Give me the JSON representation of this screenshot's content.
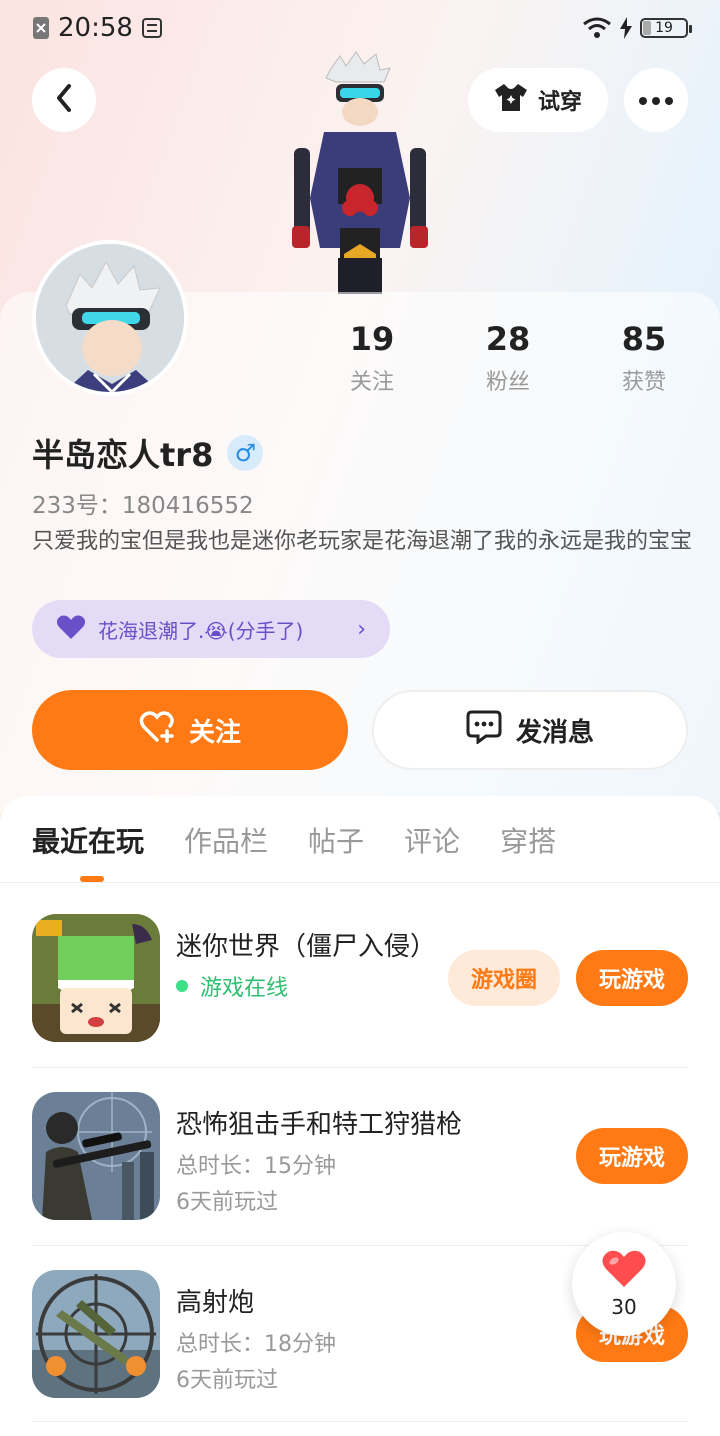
{
  "status_bar": {
    "time": "20:58",
    "battery": "19"
  },
  "header": {
    "back_icon": "chevron-left-icon",
    "try_on_label": "试穿",
    "more_icon": "more-dots-icon"
  },
  "profile": {
    "stats": [
      {
        "num": "19",
        "label": "关注"
      },
      {
        "num": "28",
        "label": "粉丝"
      },
      {
        "num": "85",
        "label": "获赞"
      }
    ],
    "username": "半岛恋人tr8",
    "gender_symbol": "♂",
    "uid": "233号：180416552",
    "bio": "只爱我的宝但是我也是迷你老玩家是花海退潮了我的永远是我的宝宝",
    "tag": "花海退潮了.😭(分手了)",
    "tag_chevron": "›"
  },
  "actions": {
    "follow_label": "关注",
    "message_label": "发消息"
  },
  "tabs": [
    "最近在玩",
    "作品栏",
    "帖子",
    "评论",
    "穿搭"
  ],
  "games": [
    {
      "title": "迷你世界（僵尸入侵）",
      "online": "游戏在线",
      "circle_label": "游戏圈",
      "play_label": "玩游戏"
    },
    {
      "title": "恐怖狙击手和特工狩猎枪",
      "duration": "总时长：15分钟",
      "last_played": "6天前玩过",
      "play_label": "玩游戏"
    },
    {
      "title": "高射炮",
      "duration": "总时长：18分钟",
      "last_played": "6天前玩过",
      "play_label": "玩游戏"
    }
  ],
  "like_float": {
    "count": "30"
  },
  "colors": {
    "accent": "#ff7a14",
    "online": "#2fbf71",
    "tag_bg": "#e4dcf7"
  }
}
